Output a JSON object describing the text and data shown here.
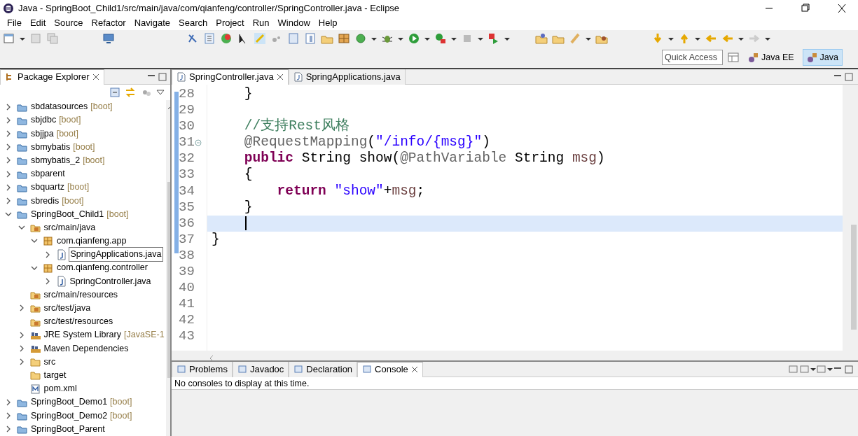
{
  "window": {
    "title": "Java - SpringBoot_Child1/src/main/java/com/qianfeng/controller/SpringController.java - Eclipse"
  },
  "menu": [
    "File",
    "Edit",
    "Source",
    "Refactor",
    "Navigate",
    "Search",
    "Project",
    "Run",
    "Window",
    "Help"
  ],
  "quick_access": {
    "placeholder": "Quick Access"
  },
  "perspectives": [
    {
      "label": "Java EE",
      "selected": false
    },
    {
      "label": "Java",
      "selected": true
    }
  ],
  "package_explorer": {
    "title": "Package Explorer",
    "tree": [
      {
        "label": "sbdatasources",
        "decoration": "[boot]",
        "kind": "project",
        "expanded": false,
        "outlined": false
      },
      {
        "label": "sbjdbc",
        "decoration": "[boot]",
        "kind": "project",
        "expanded": false,
        "outlined": false
      },
      {
        "label": "sbjjpa",
        "decoration": "[boot]",
        "kind": "project",
        "expanded": false,
        "outlined": false
      },
      {
        "label": "sbmybatis",
        "decoration": "[boot]",
        "kind": "project",
        "expanded": false,
        "outlined": false
      },
      {
        "label": "sbmybatis_2",
        "decoration": "[boot]",
        "kind": "project",
        "expanded": false,
        "outlined": false
      },
      {
        "label": "sbparent",
        "kind": "project",
        "expanded": false,
        "outlined": false
      },
      {
        "label": "sbquartz",
        "decoration": "[boot]",
        "kind": "project",
        "expanded": false,
        "outlined": false
      },
      {
        "label": "sbredis",
        "decoration": "[boot]",
        "kind": "project",
        "expanded": false,
        "outlined": false
      },
      {
        "label": "SpringBoot_Child1",
        "decoration": "[boot]",
        "kind": "project",
        "expanded": true,
        "outlined": false,
        "children": [
          {
            "label": "src/main/java",
            "kind": "source",
            "expanded": true,
            "outlined": false,
            "children": [
              {
                "label": "com.qianfeng.app",
                "kind": "package",
                "expanded": true,
                "outlined": false,
                "children": [
                  {
                    "label": "SpringApplications.java",
                    "kind": "java",
                    "expanded": false,
                    "outlined": true
                  }
                ]
              },
              {
                "label": "com.qianfeng.controller",
                "kind": "package",
                "expanded": true,
                "outlined": false,
                "children": [
                  {
                    "label": "SpringController.java",
                    "kind": "java",
                    "expanded": false,
                    "outlined": false
                  }
                ]
              }
            ]
          },
          {
            "label": "src/main/resources",
            "kind": "source",
            "outlined": false
          },
          {
            "label": "src/test/java",
            "kind": "source",
            "expanded": false,
            "outlined": false
          },
          {
            "label": "src/test/resources",
            "kind": "source",
            "outlined": false
          },
          {
            "label": "JRE System Library",
            "decoration": "[JavaSE-1",
            "kind": "library",
            "expanded": false,
            "outlined": false
          },
          {
            "label": "Maven Dependencies",
            "kind": "library",
            "expanded": false,
            "outlined": false
          },
          {
            "label": "src",
            "kind": "folder",
            "expanded": false,
            "outlined": false
          },
          {
            "label": "target",
            "kind": "folder",
            "outlined": false
          },
          {
            "label": "pom.xml",
            "kind": "pom",
            "outlined": false
          }
        ]
      },
      {
        "label": "SpringBoot_Demo1",
        "decoration": "[boot]",
        "kind": "project",
        "expanded": false,
        "outlined": false
      },
      {
        "label": "SpringBoot_Demo2",
        "decoration": "[boot]",
        "kind": "project",
        "expanded": false,
        "outlined": false
      },
      {
        "label": "SpringBoot_Parent",
        "kind": "project",
        "expanded": false,
        "outlined": false
      }
    ]
  },
  "editor": {
    "tabs": [
      {
        "label": "SpringController.java",
        "selected": true
      },
      {
        "label": "SpringApplications.java",
        "selected": false
      }
    ],
    "lines": [
      {
        "number": "28",
        "changed": true,
        "fold": false,
        "current": false,
        "segments": [
          {
            "kind": "plain",
            "text": "    }"
          }
        ]
      },
      {
        "number": "29",
        "changed": true,
        "fold": false,
        "current": false
      },
      {
        "number": "30",
        "changed": true,
        "fold": false,
        "current": false,
        "segments": [
          {
            "kind": "comment",
            "text": "    //支持Rest风格"
          }
        ]
      },
      {
        "number": "31",
        "changed": true,
        "fold": true,
        "current": false,
        "segments": [
          {
            "kind": "annotation",
            "text": "    @RequestMapping"
          },
          {
            "kind": "plain",
            "text": "("
          },
          {
            "kind": "string",
            "text": "\"/info/{msg}\""
          },
          {
            "kind": "plain",
            "text": ")"
          }
        ]
      },
      {
        "number": "32",
        "changed": true,
        "fold": false,
        "current": false,
        "segments": [
          {
            "kind": "keyword",
            "text": "    public"
          },
          {
            "kind": "plain",
            "text": " String show("
          },
          {
            "kind": "annotation",
            "text": "@PathVariable"
          },
          {
            "kind": "plain",
            "text": " String "
          },
          {
            "kind": "variable",
            "text": "msg"
          },
          {
            "kind": "plain",
            "text": ")"
          }
        ]
      },
      {
        "number": "33",
        "changed": true,
        "fold": false,
        "current": false,
        "segments": [
          {
            "kind": "plain",
            "text": "    {"
          }
        ]
      },
      {
        "number": "34",
        "changed": true,
        "fold": false,
        "current": false,
        "segments": [
          {
            "kind": "keyword",
            "text": "        return"
          },
          {
            "kind": "string",
            "text": " \"show\""
          },
          {
            "kind": "plain",
            "text": "+"
          },
          {
            "kind": "variable",
            "text": "msg"
          },
          {
            "kind": "plain",
            "text": ";"
          }
        ]
      },
      {
        "number": "35",
        "changed": true,
        "fold": false,
        "current": false,
        "segments": [
          {
            "kind": "plain",
            "text": "    }"
          }
        ]
      },
      {
        "number": "36",
        "changed": true,
        "fold": false,
        "current": true
      },
      {
        "number": "37",
        "changed": true,
        "fold": false,
        "current": false,
        "segments": [
          {
            "kind": "plain",
            "text": "}"
          }
        ]
      },
      {
        "number": "38",
        "changed": false,
        "fold": false,
        "current": false
      },
      {
        "number": "39",
        "changed": false,
        "fold": false,
        "current": false
      },
      {
        "number": "40",
        "changed": false,
        "fold": false,
        "current": false
      },
      {
        "number": "41",
        "changed": false,
        "fold": false,
        "current": false
      },
      {
        "number": "42",
        "changed": false,
        "fold": false,
        "current": false
      },
      {
        "number": "43",
        "changed": false,
        "fold": false,
        "current": false
      }
    ]
  },
  "bottom_panel": {
    "tabs": [
      {
        "label": "Problems",
        "selected": false
      },
      {
        "label": "Javadoc",
        "selected": false
      },
      {
        "label": "Declaration",
        "selected": false
      },
      {
        "label": "Console",
        "selected": true
      }
    ],
    "message": "No consoles to display at this time."
  }
}
